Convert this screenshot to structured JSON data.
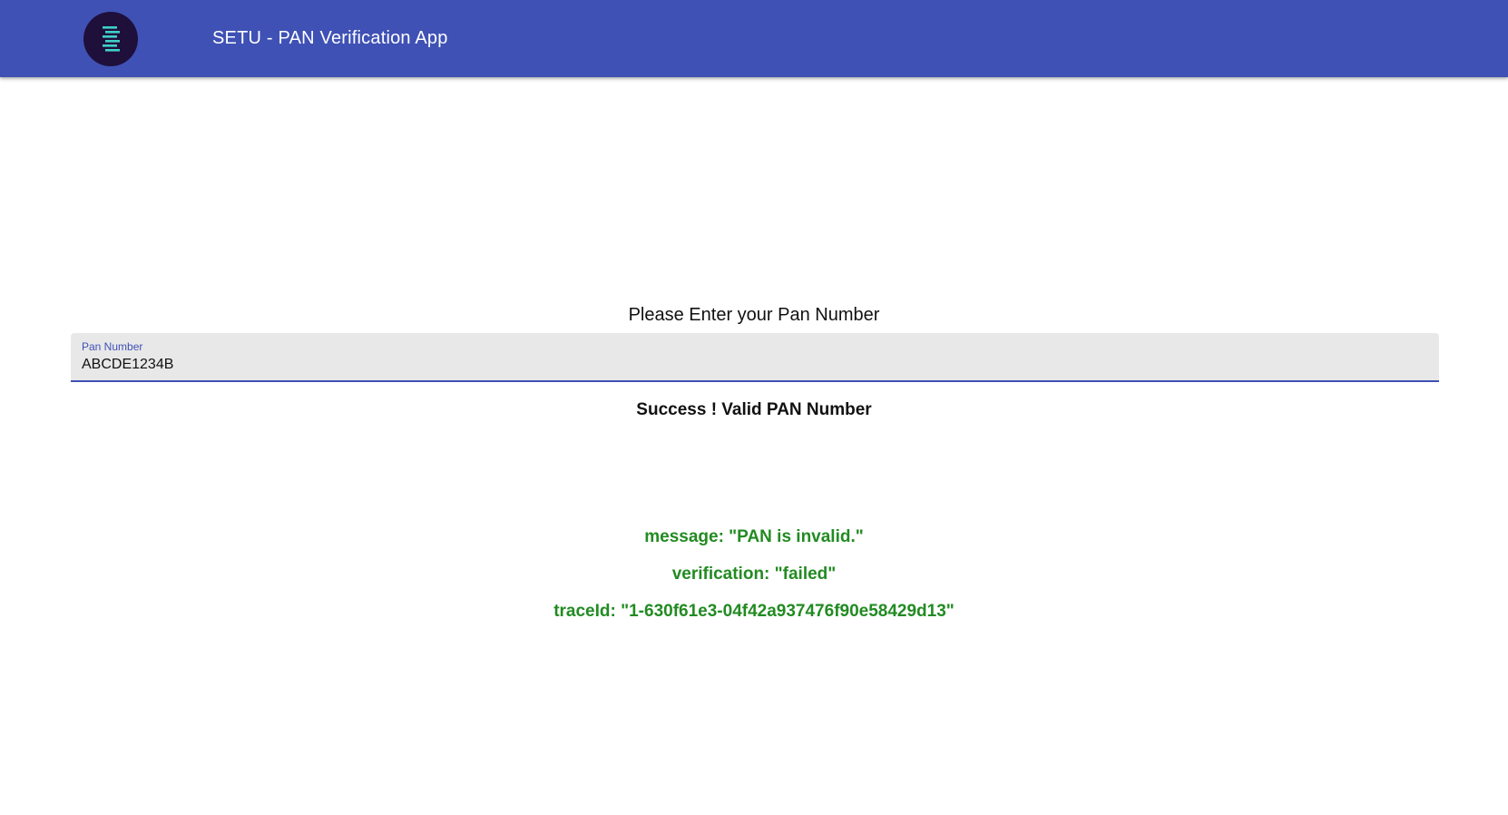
{
  "header": {
    "title": "SETU - PAN Verification App",
    "logo_icon": "setu-logo-icon",
    "bar_color": "#3f51b5"
  },
  "form": {
    "prompt": "Please Enter your Pan Number",
    "pan_field": {
      "label": "Pan Number",
      "value": "ABCDE1234B"
    }
  },
  "status": {
    "text": "Success ! Valid PAN Number"
  },
  "result": {
    "color": "#228b22",
    "lines": [
      "message: \"PAN is invalid.\"",
      "verification: \"failed\"",
      "traceId: \"1-630f61e3-04f42a937476f90e58429d13\""
    ]
  }
}
